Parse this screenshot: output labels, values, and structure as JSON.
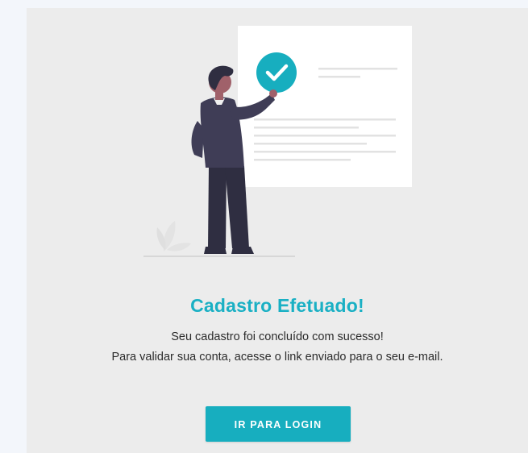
{
  "colors": {
    "accent": "#17aebf",
    "title": "#1ab0c4",
    "card_background": "#ececec",
    "page_background": "#f3f6fb",
    "person_suit": "#3f3d56",
    "skin": "#a0616a"
  },
  "illustration": {
    "icons": [
      "person-illustration",
      "document-illustration",
      "check-circle-icon",
      "plant-icon"
    ]
  },
  "success": {
    "title": "Cadastro Efetuado!",
    "message_line1": "Seu cadastro foi concluído com sucesso!",
    "message_line2": "Para validar sua conta, acesse o link enviado para o seu e-mail.",
    "login_button": "IR PARA LOGIN"
  }
}
